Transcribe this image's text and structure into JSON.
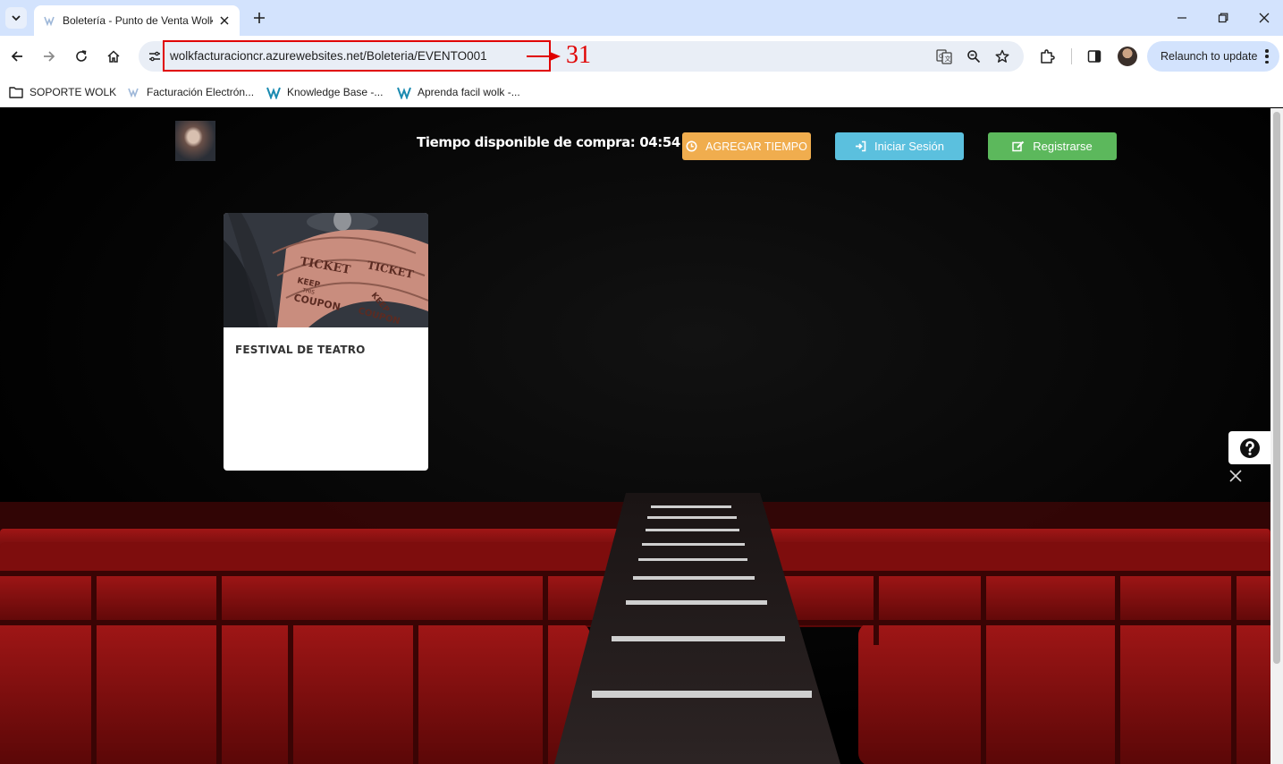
{
  "browser": {
    "tab_title": "Boletería - Punto de Venta Wolk",
    "url": "wolkfacturacioncr.azurewebsites.net/Boleteria/EVENTO001",
    "relaunch_label": "Relaunch to update",
    "bookmarks": [
      {
        "label": "SOPORTE WOLK",
        "icon": "folder-icon"
      },
      {
        "label": "Facturación Electrón...",
        "icon": "wolk-favicon"
      },
      {
        "label": "Knowledge Base -...",
        "icon": "wolk-w-icon"
      },
      {
        "label": "Aprenda facil wolk -...",
        "icon": "wolk-w-icon"
      }
    ]
  },
  "annotation": {
    "number": "31",
    "color": "#e00000"
  },
  "header": {
    "timer_text": "Tiempo disponible de compra: 04:54",
    "add_time_label": "AGREGAR TIEMPO",
    "login_label": "Iniciar Sesión",
    "register_label": "Registrarse"
  },
  "colors": {
    "add_time": "#f0ad4e",
    "login": "#5bc0de",
    "register": "#5cb85c",
    "seat_red": "#8b1010"
  },
  "events": [
    {
      "title": "FESTIVAL DE TEATRO",
      "image": "ticket-rolls-image"
    }
  ]
}
